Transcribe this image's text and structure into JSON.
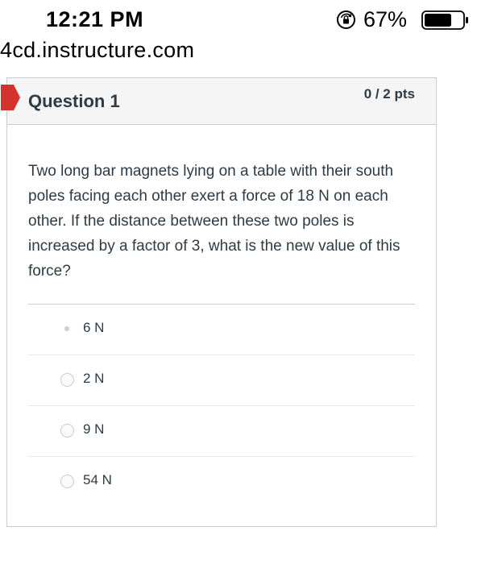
{
  "status_bar": {
    "time": "12:21 PM",
    "battery_percent": "67%",
    "icons": [
      "orientation-lock-icon",
      "battery-icon"
    ]
  },
  "browser": {
    "url": "4cd.instructure.com"
  },
  "question": {
    "title": "Question 1",
    "points": "0 / 2 pts",
    "text": "Two long bar magnets lying on a table with their south poles facing each other exert a force of 18 N on each other.  If the distance between these two poles is increased by a factor of 3, what is the new value of this force?",
    "answers": [
      {
        "label": "6 N",
        "selected": true
      },
      {
        "label": "2 N",
        "selected": false
      },
      {
        "label": "9 N",
        "selected": false
      },
      {
        "label": "54 N",
        "selected": false
      }
    ]
  },
  "colors": {
    "flag": "#d3322f",
    "border": "#c7cdd1",
    "header_bg": "#f5f5f5",
    "text": "#2d3b45"
  }
}
